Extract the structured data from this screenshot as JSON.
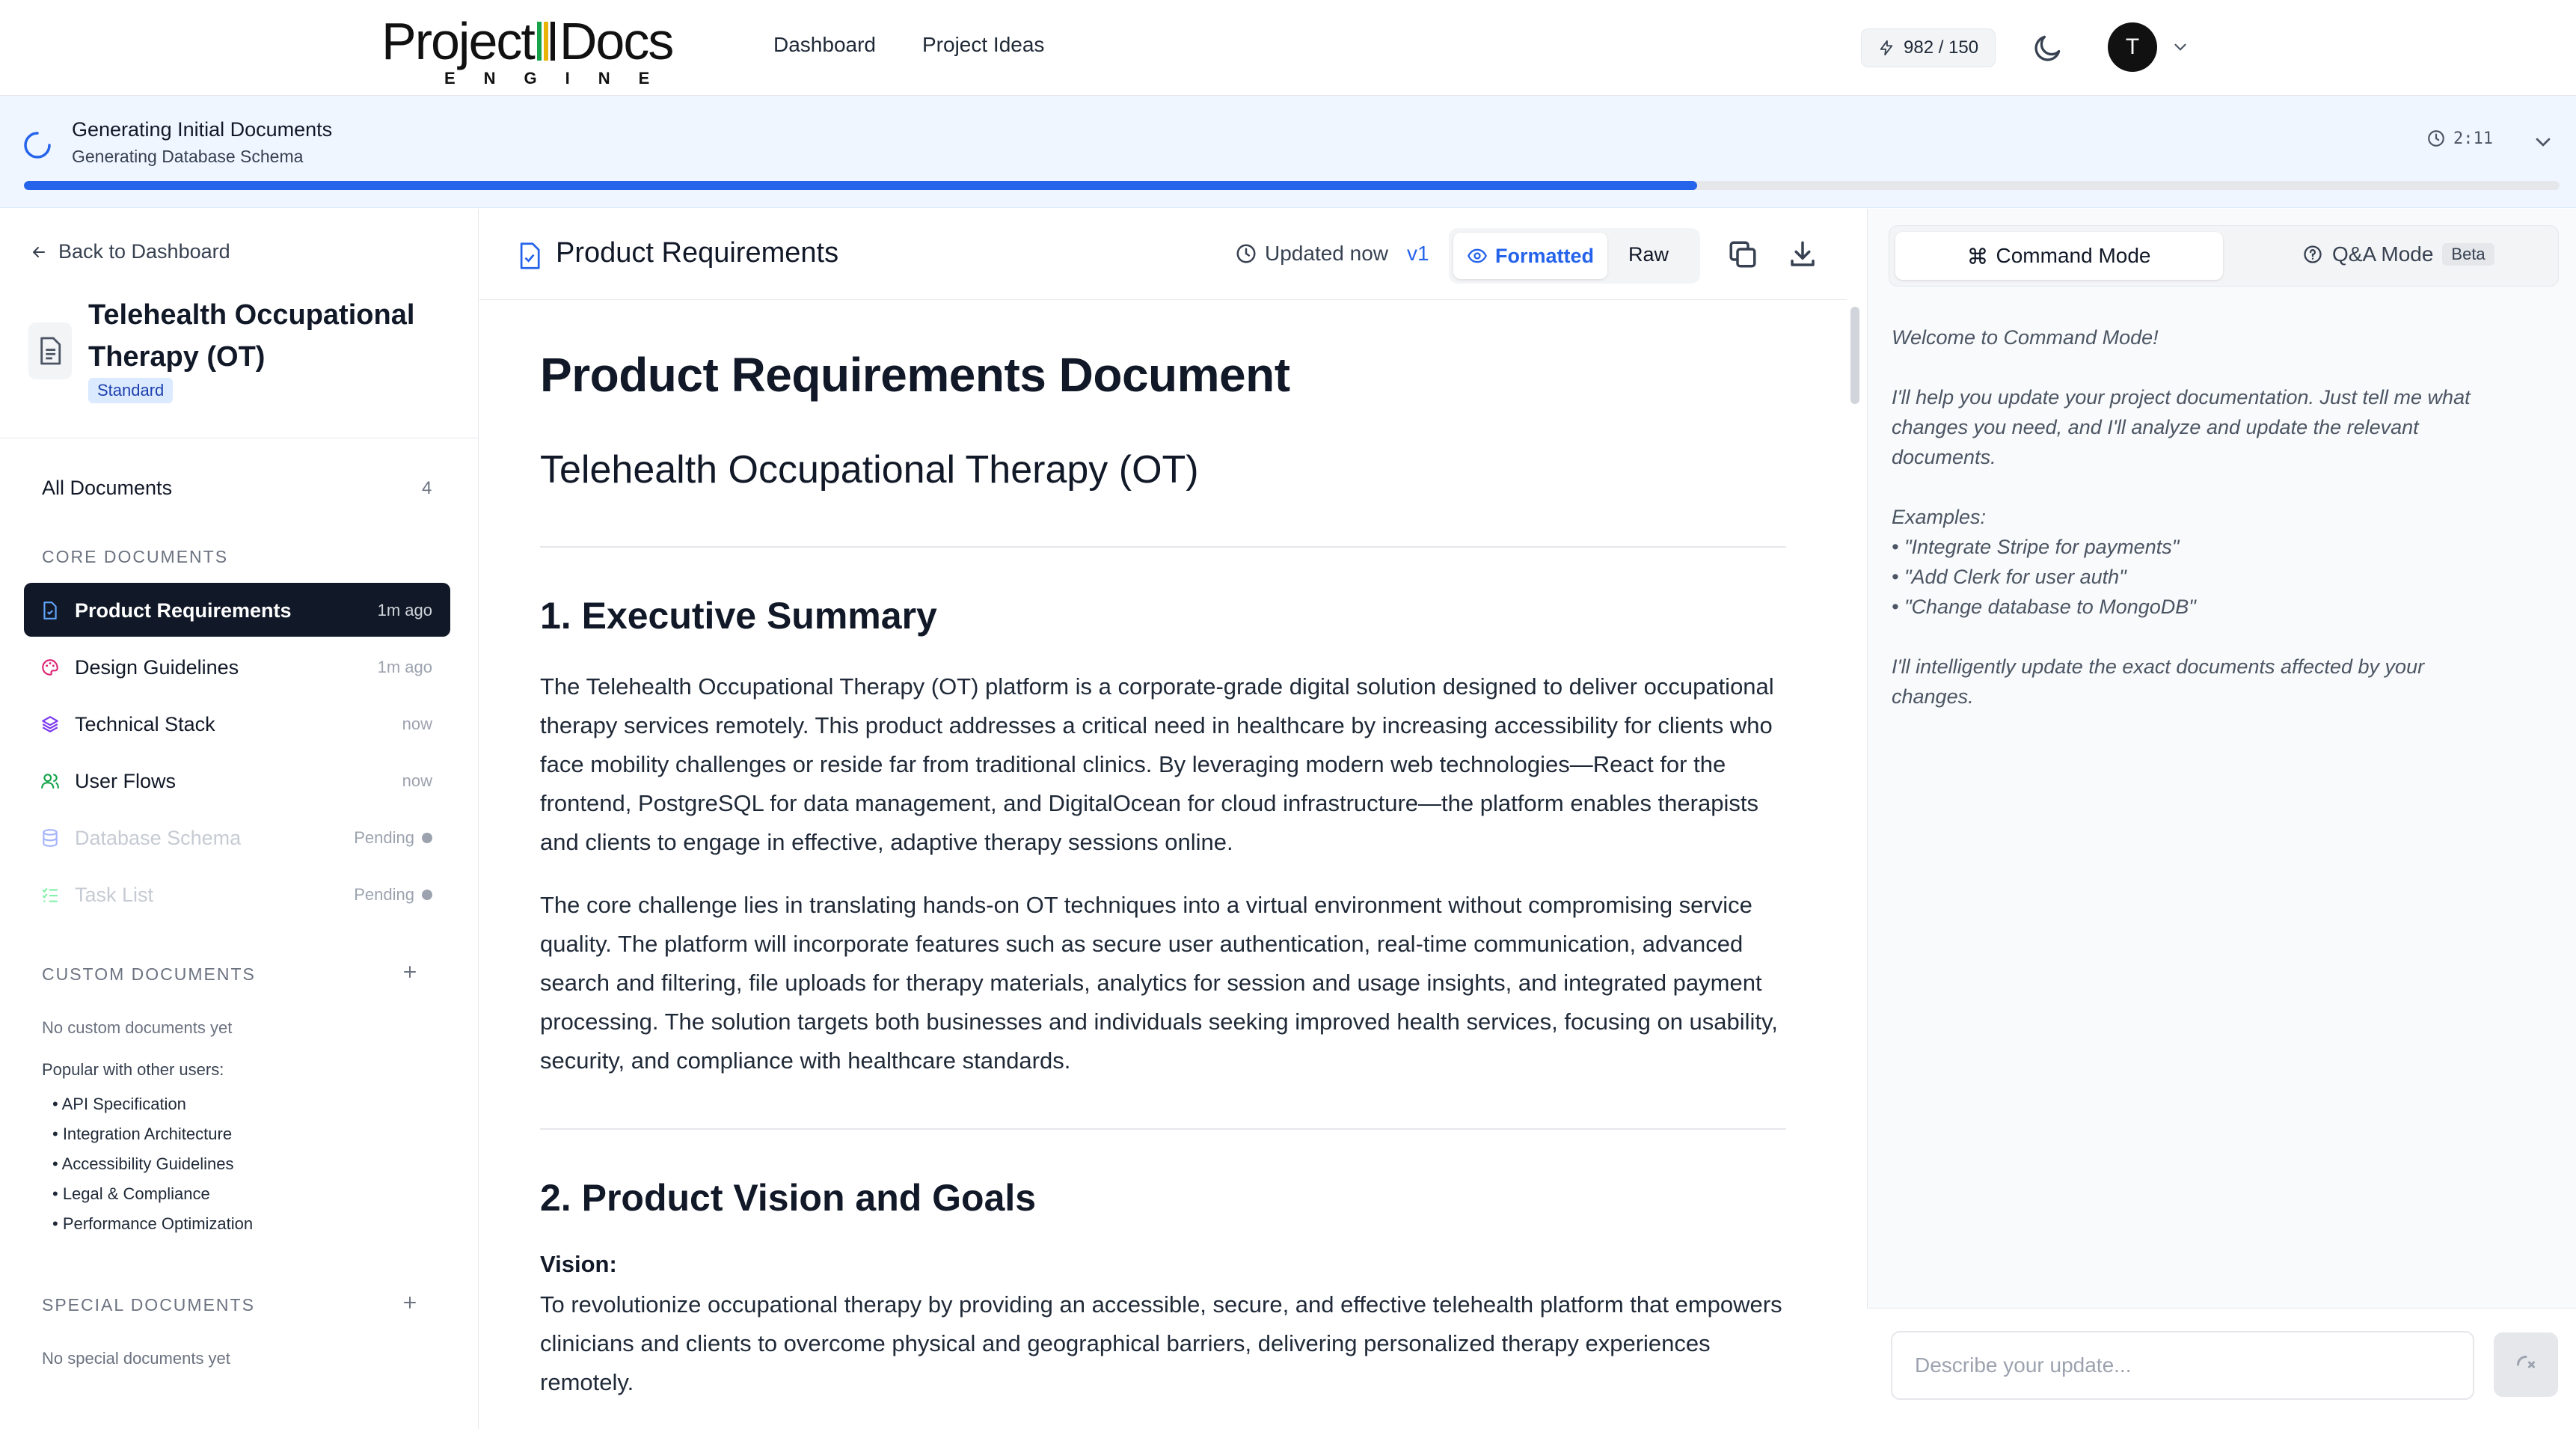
{
  "nav": {
    "logo_main_a": "Project",
    "logo_main_b": "Docs",
    "logo_sub": "ENGINE",
    "dashboard": "Dashboard",
    "project_ideas": "Project Ideas",
    "credits": "982 / 150",
    "avatar_initial": "T"
  },
  "banner": {
    "title": "Generating Initial Documents",
    "subtitle": "Generating Database Schema",
    "timer": "2:11",
    "progress_fraction": 0.66
  },
  "sidebar": {
    "back": "Back to Dashboard",
    "project_title": "Telehealth Occupational Therapy (OT)",
    "project_badge": "Standard",
    "all_documents": "All Documents",
    "all_count": "4",
    "core_heading": "CORE DOCUMENTS",
    "core_docs": [
      {
        "label": "Product Requirements",
        "time": "1m ago",
        "icon": "file-check-icon",
        "color": "#2563eb"
      },
      {
        "label": "Design Guidelines",
        "time": "1m ago",
        "icon": "palette-icon",
        "color": "#db2777"
      },
      {
        "label": "Technical Stack",
        "time": "now",
        "icon": "layers-icon",
        "color": "#7c3aed"
      },
      {
        "label": "User Flows",
        "time": "now",
        "icon": "users-icon",
        "color": "#16a34a"
      },
      {
        "label": "Database Schema",
        "time": "Pending",
        "icon": "database-icon",
        "color": "#a5b4fc"
      },
      {
        "label": "Task List",
        "time": "Pending",
        "icon": "list-check-icon",
        "color": "#86efac"
      }
    ],
    "custom_heading": "CUSTOM DOCUMENTS",
    "custom_empty": "No custom documents yet",
    "popular_label": "Popular with other users:",
    "popular": [
      "• API Specification",
      "• Integration Architecture",
      "• Accessibility Guidelines",
      "• Legal & Compliance",
      "• Performance Optimization"
    ],
    "special_heading": "SPECIAL DOCUMENTS",
    "special_empty": "No special documents yet"
  },
  "doc": {
    "header_title": "Product Requirements",
    "updated": "Updated now",
    "version": "v1",
    "formatted": "Formatted",
    "raw": "Raw",
    "h1": "Product Requirements Document",
    "h2": "Telehealth Occupational Therapy (OT)",
    "s1_title": "1. Executive Summary",
    "s1_p1": "The Telehealth Occupational Therapy (OT) platform is a corporate-grade digital solution designed to deliver occupational therapy services remotely. This product addresses a critical need in healthcare by increasing accessibility for clients who face mobility challenges or reside far from traditional clinics. By leveraging modern web technologies—React for the frontend, PostgreSQL for data management, and DigitalOcean for cloud infrastructure—the platform enables therapists and clients to engage in effective, adaptive therapy sessions online.",
    "s1_p2": "The core challenge lies in translating hands-on OT techniques into a virtual environment without compromising service quality. The platform will incorporate features such as secure user authentication, real-time communication, advanced search and filtering, file uploads for therapy materials, analytics for session and usage insights, and integrated payment processing. The solution targets both businesses and individuals seeking improved health services, focusing on usability, security, and compliance with healthcare standards.",
    "s2_title": "2. Product Vision and Goals",
    "vision_label": "Vision:",
    "vision_text": "To revolutionize occupational therapy by providing an accessible, secure, and effective telehealth platform that empowers clinicians and clients to overcome physical and geographical barriers, delivering personalized therapy experiences remotely."
  },
  "panel": {
    "command_mode": "Command Mode",
    "qa_mode": "Q&A Mode",
    "beta": "Beta",
    "welcome_1": "Welcome to Command Mode!",
    "welcome_2": "I'll help you update your project documentation. Just tell me what changes you need, and I'll analyze and update the relevant documents.",
    "examples_label": "Examples:",
    "example_1": "• \"Integrate Stripe for payments\"",
    "example_2": "• \"Add Clerk for user auth\"",
    "example_3": "• \"Change database to MongoDB\"",
    "welcome_3": "I'll intelligently update the exact documents affected by your changes.",
    "input_placeholder": "Describe your update..."
  },
  "colors": {
    "accent": "#2563eb",
    "active_bg": "#111827",
    "banner_bg": "#eff6ff"
  }
}
